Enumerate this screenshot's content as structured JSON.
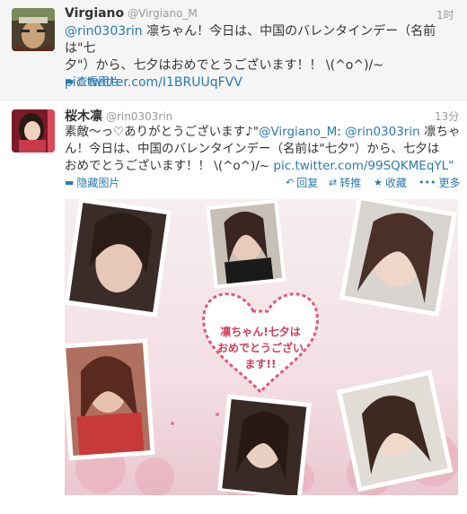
{
  "tweets": [
    {
      "name": "Virgiano",
      "handle": "@Virgiano_M",
      "time": "1时",
      "mention": "@rin0303rin",
      "text_part1": " 凛ちゃん！今日は、中国のバレンタインデー（名前は\"七",
      "text_part2": "夕\"）から、七夕はおめでとうございます！！ \\(^o^)/~",
      "link": "pic.twitter.com/I1BRUUqFVV",
      "action_label": "查看图片"
    },
    {
      "name": "桜木凛",
      "handle": "@rin0303rin",
      "time": "13分",
      "line1": "素敵〜っ♡ありがとうございます♪\"",
      "mention1": "@Virgiano_M",
      "mention2": "@rin0303rin",
      "line1_tail": "凛ちゃ",
      "line2": "ん！今日は、中国のバレンタインデー（名前は\"七夕\"）から、七夕は",
      "line3": "おめでとうございます！！ \\(^o^)/~",
      "link": "pic.twitter.com/99SQKMEqYL\"",
      "actions": {
        "hide": "隐藏图片",
        "reply": "回复",
        "retweet": "转推",
        "favorite": "收藏",
        "more": "更多"
      },
      "photo_message": "凛ちゃん!七夕はおめでとうございます!!"
    }
  ]
}
